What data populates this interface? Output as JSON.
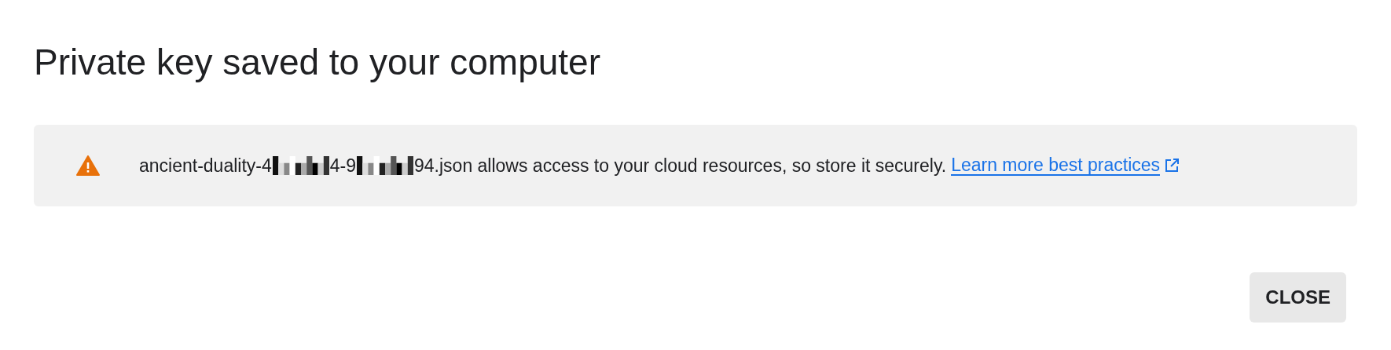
{
  "dialog": {
    "title": "Private key saved to your computer",
    "notice": {
      "kind": "warning",
      "segments": [
        {
          "kind": "text",
          "text": "ancient-duality-4"
        },
        {
          "kind": "redacted"
        },
        {
          "kind": "text",
          "text": "4-9"
        },
        {
          "kind": "redacted"
        },
        {
          "kind": "text",
          "text": "94.json allows access to your cloud resources, so store it securely."
        }
      ],
      "link": {
        "label": "Learn more best practices",
        "external": true
      }
    },
    "buttons": [
      {
        "label": "CLOSE"
      }
    ]
  }
}
